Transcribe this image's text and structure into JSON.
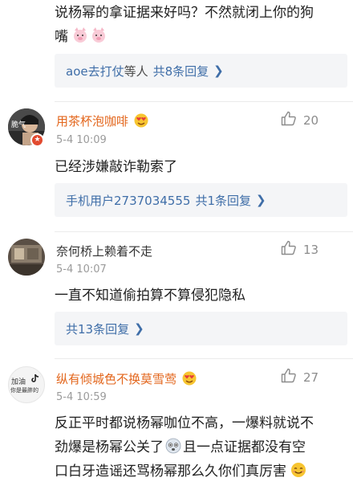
{
  "comments": [
    {
      "text_lines": [
        "说杨幂的拿证据来好吗？不然就闭上你的狗",
        "嘴"
      ],
      "reply_summary": {
        "user": "aoe去打仗",
        "suffix": "等人",
        "count": "共8条回复"
      }
    },
    {
      "username": "用茶杯泡咖啡",
      "avatar_text": "脆气",
      "time": "5-4 10:09",
      "likes": "20",
      "text": "已经涉嫌敲诈勒索了",
      "reply_summary": {
        "user": "手机用户2737034555",
        "count": "共1条回复"
      }
    },
    {
      "username": "奈何桥上赖着不走",
      "time": "5-4 10:07",
      "likes": "13",
      "text": "一直不知道偷拍算不算侵犯隐私",
      "reply_summary": {
        "count": "共13条回复"
      }
    },
    {
      "username": "纵有倾城色不换莫雪莺",
      "avatar_text_top": "加油",
      "avatar_text_bottom": "你是最胖的",
      "time": "5-4 10:59",
      "likes": "27",
      "text_lines": [
        "反正平时都说杨幂咖位不高，一爆料就说不",
        "劲爆是杨幂公关了",
        "且一点证据都没有空",
        "口白牙造谣还骂杨幂那么久你们真厉害"
      ]
    }
  ],
  "colors": {
    "username_accent": "#e3661c",
    "reply_link": "#3f6ea8",
    "reply_bg": "#f4f5f7",
    "timestamp": "#9b9b9b"
  }
}
